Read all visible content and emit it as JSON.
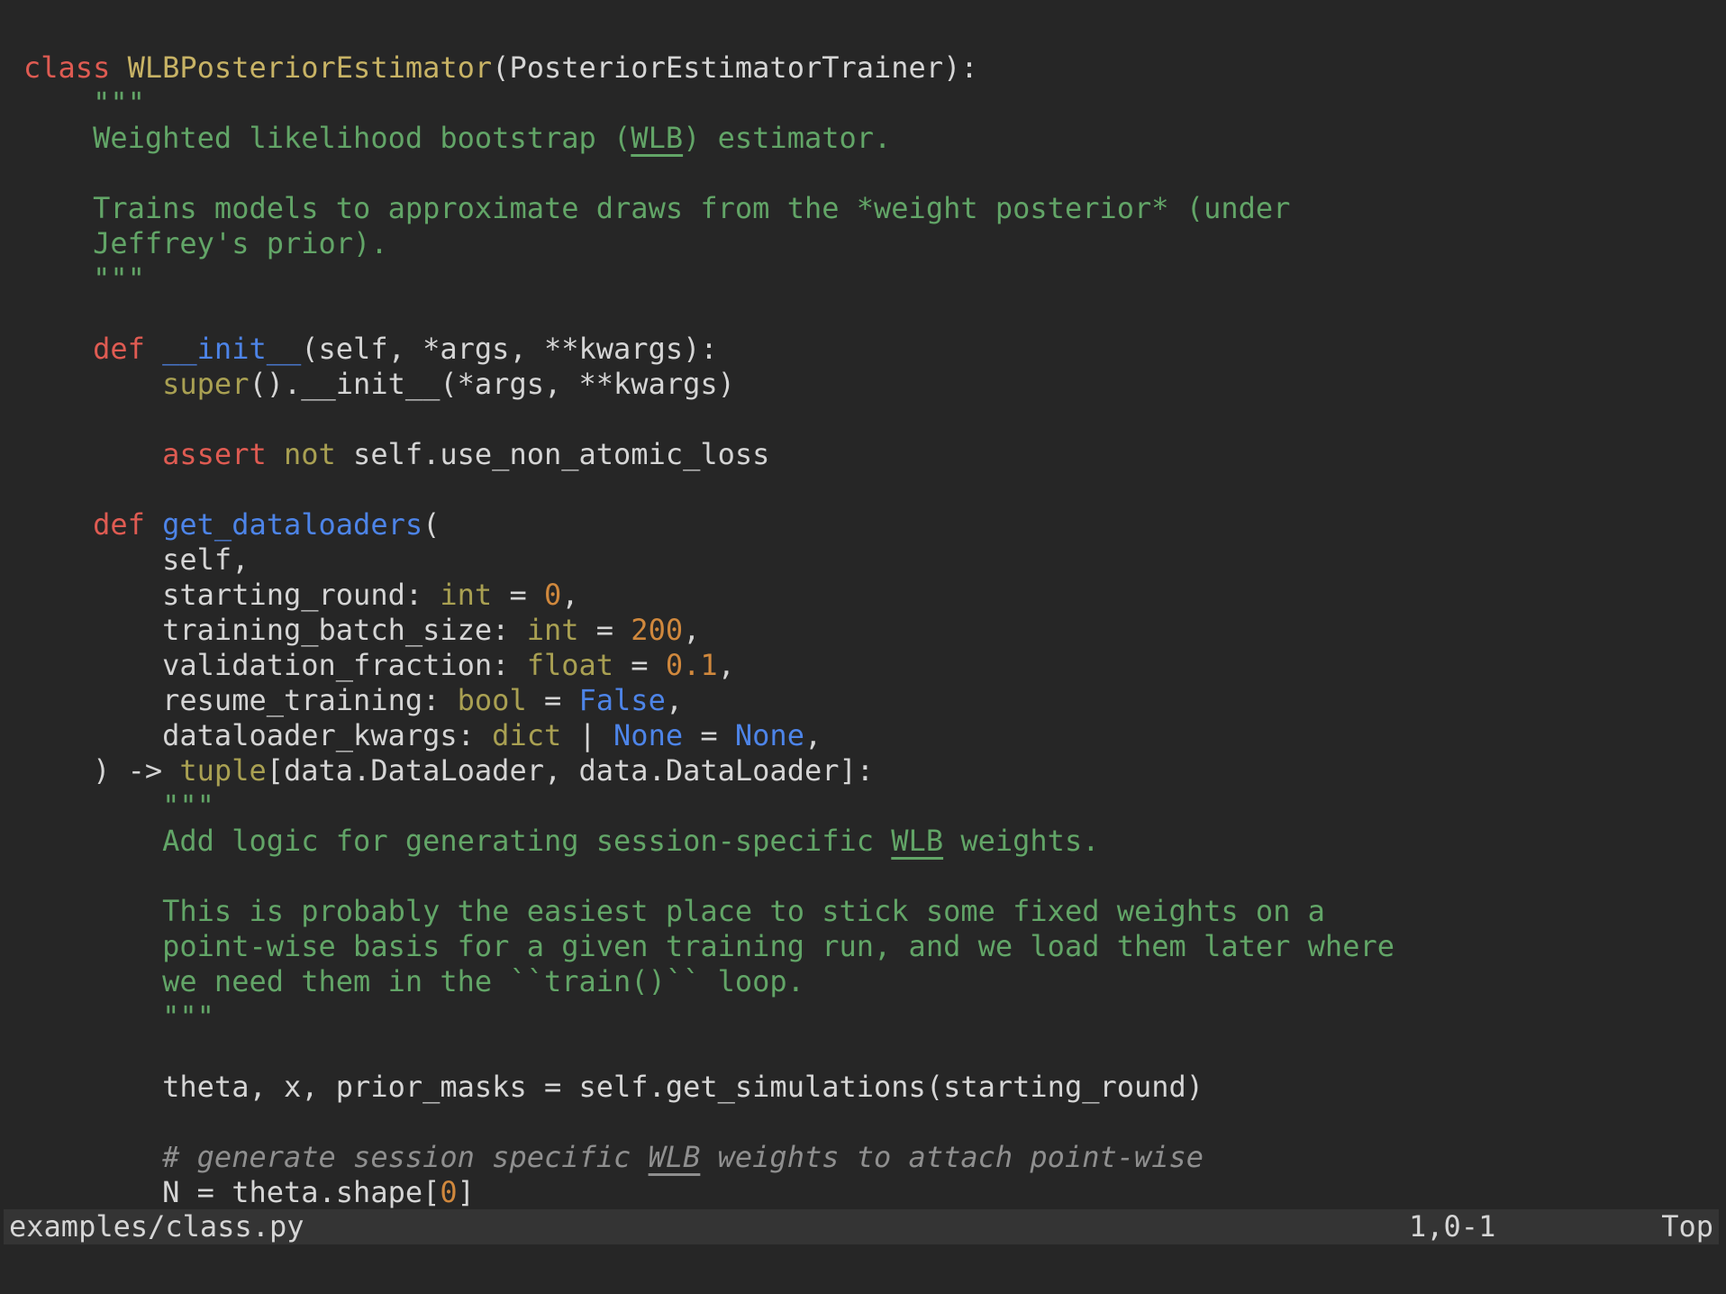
{
  "editor": {
    "language": "python",
    "lines": [
      [
        [
          "kw",
          "class"
        ],
        [
          "plain",
          " "
        ],
        [
          "cls",
          "WLBPosteriorEstimator"
        ],
        [
          "plain",
          "(PosteriorEstimatorTrainer):"
        ]
      ],
      [
        [
          "str",
          "    \"\"\""
        ]
      ],
      [
        [
          "str",
          "    Weighted likelihood bootstrap ("
        ],
        [
          "stru",
          "WLB"
        ],
        [
          "str",
          ") estimator."
        ]
      ],
      [],
      [
        [
          "str",
          "    Trains models to approximate draws from the *weight posterior* (under"
        ]
      ],
      [
        [
          "str",
          "    Jeffrey's prior)."
        ]
      ],
      [
        [
          "str",
          "    \"\"\""
        ]
      ],
      [],
      [
        [
          "plain",
          "    "
        ],
        [
          "kw",
          "def"
        ],
        [
          "plain",
          " "
        ],
        [
          "blue",
          "__init__"
        ],
        [
          "plain",
          "(self, *args, **kwargs):"
        ]
      ],
      [
        [
          "plain",
          "        "
        ],
        [
          "type",
          "super"
        ],
        [
          "plain",
          "().__init__(*args, **kwargs)"
        ]
      ],
      [],
      [
        [
          "plain",
          "        "
        ],
        [
          "kw",
          "assert"
        ],
        [
          "plain",
          " "
        ],
        [
          "type",
          "not"
        ],
        [
          "plain",
          " self.use_non_atomic_loss"
        ]
      ],
      [],
      [
        [
          "plain",
          "    "
        ],
        [
          "kw",
          "def"
        ],
        [
          "plain",
          " "
        ],
        [
          "blue",
          "get_dataloaders"
        ],
        [
          "plain",
          "("
        ]
      ],
      [
        [
          "plain",
          "        self,"
        ]
      ],
      [
        [
          "plain",
          "        starting_round: "
        ],
        [
          "type",
          "int"
        ],
        [
          "plain",
          " = "
        ],
        [
          "num",
          "0"
        ],
        [
          "plain",
          ","
        ]
      ],
      [
        [
          "plain",
          "        training_batch_size: "
        ],
        [
          "type",
          "int"
        ],
        [
          "plain",
          " = "
        ],
        [
          "num",
          "200"
        ],
        [
          "plain",
          ","
        ]
      ],
      [
        [
          "plain",
          "        validation_fraction: "
        ],
        [
          "type",
          "float"
        ],
        [
          "plain",
          " = "
        ],
        [
          "num",
          "0.1"
        ],
        [
          "plain",
          ","
        ]
      ],
      [
        [
          "plain",
          "        resume_training: "
        ],
        [
          "type",
          "bool"
        ],
        [
          "plain",
          " = "
        ],
        [
          "blue",
          "False"
        ],
        [
          "plain",
          ","
        ]
      ],
      [
        [
          "plain",
          "        dataloader_kwargs: "
        ],
        [
          "type",
          "dict"
        ],
        [
          "plain",
          " | "
        ],
        [
          "blue",
          "None"
        ],
        [
          "plain",
          " = "
        ],
        [
          "blue",
          "None"
        ],
        [
          "plain",
          ","
        ]
      ],
      [
        [
          "plain",
          "    ) -> "
        ],
        [
          "type",
          "tuple"
        ],
        [
          "plain",
          "[data.DataLoader, data.DataLoader]:"
        ]
      ],
      [
        [
          "str",
          "        \"\"\""
        ]
      ],
      [
        [
          "str",
          "        Add logic for generating session-specific "
        ],
        [
          "stru",
          "WLB"
        ],
        [
          "str",
          " weights."
        ]
      ],
      [],
      [
        [
          "str",
          "        This is probably the easiest place to stick some fixed weights on a"
        ]
      ],
      [
        [
          "str",
          "        point-wise basis for a given training run, and we load them later where"
        ]
      ],
      [
        [
          "str",
          "        we need them in the ``train()`` loop."
        ]
      ],
      [
        [
          "str",
          "        \"\"\""
        ]
      ],
      [],
      [
        [
          "plain",
          "        theta, x, prior_masks = self.get_simulations(starting_round)"
        ]
      ],
      [],
      [
        [
          "com",
          "        # generate session specific "
        ],
        [
          "comu",
          "WLB"
        ],
        [
          "com",
          " weights to attach point-wise"
        ]
      ],
      [
        [
          "plain",
          "        N = theta.shape["
        ],
        [
          "num",
          "0"
        ],
        [
          "plain",
          "]"
        ]
      ]
    ]
  },
  "status_bar": {
    "filename": "examples/class.py",
    "cursor_position": "1,0-1",
    "scroll_position": "Top"
  },
  "colors": {
    "background": "#262626",
    "status_bar_background": "#343434",
    "text": "#d5d5d5",
    "keyword": "#df5b52",
    "function": "#4d84e8",
    "class_name": "#c8b365",
    "type": "#a9a052",
    "number": "#d0883d",
    "string": "#62a567",
    "comment": "#8f8f8f"
  }
}
